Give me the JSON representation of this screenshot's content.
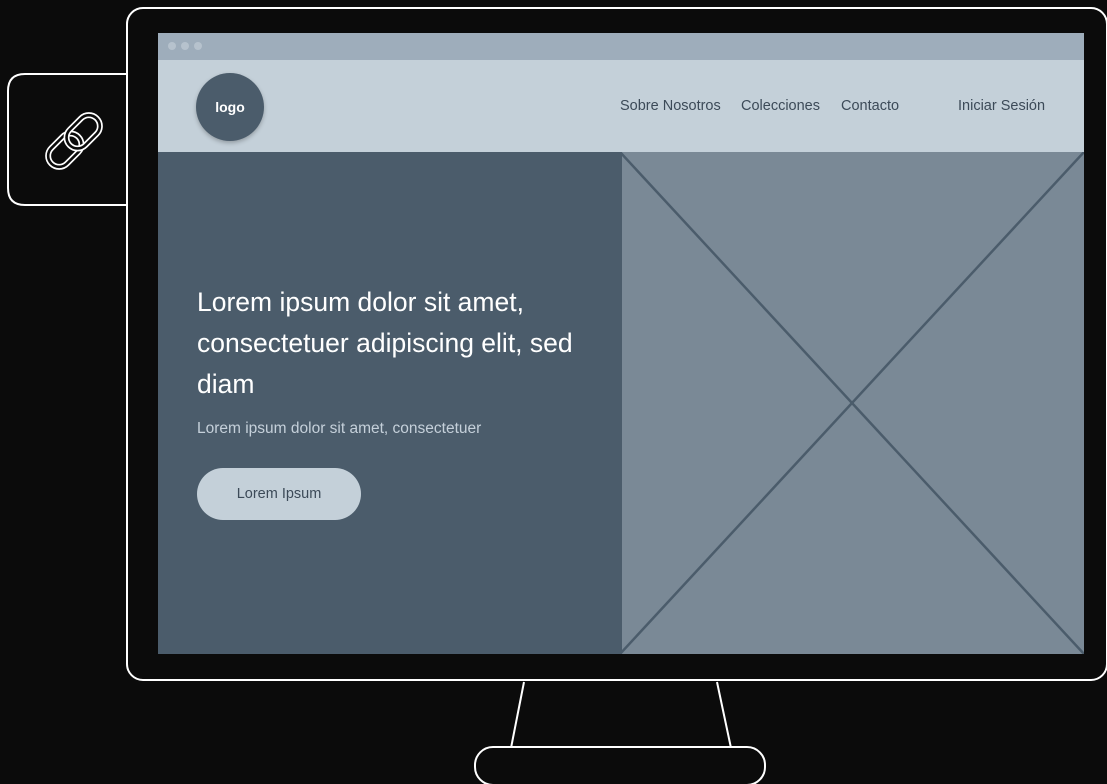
{
  "navbar": {
    "logo_text": "logo",
    "links": [
      "Sobre Nosotros",
      "Colecciones",
      "Contacto"
    ],
    "login_label": "Iniciar Sesión"
  },
  "hero": {
    "title": "Lorem ipsum dolor sit amet, consectetuer adipiscing elit, sed diam",
    "subtitle": "Lorem ipsum dolor sit amet, consectetuer",
    "button_label": "Lorem Ipsum",
    "image_icon": "image-placeholder-icon"
  },
  "side_tab": {
    "icon": "link-icon"
  },
  "colors": {
    "background": "#0b0b0b",
    "outline": "#ffffff",
    "navbar": "#c4d0d9",
    "titlebar": "#9eadbb",
    "hero_panel": "#4b5c6b",
    "image_placeholder": "#7a8996"
  }
}
